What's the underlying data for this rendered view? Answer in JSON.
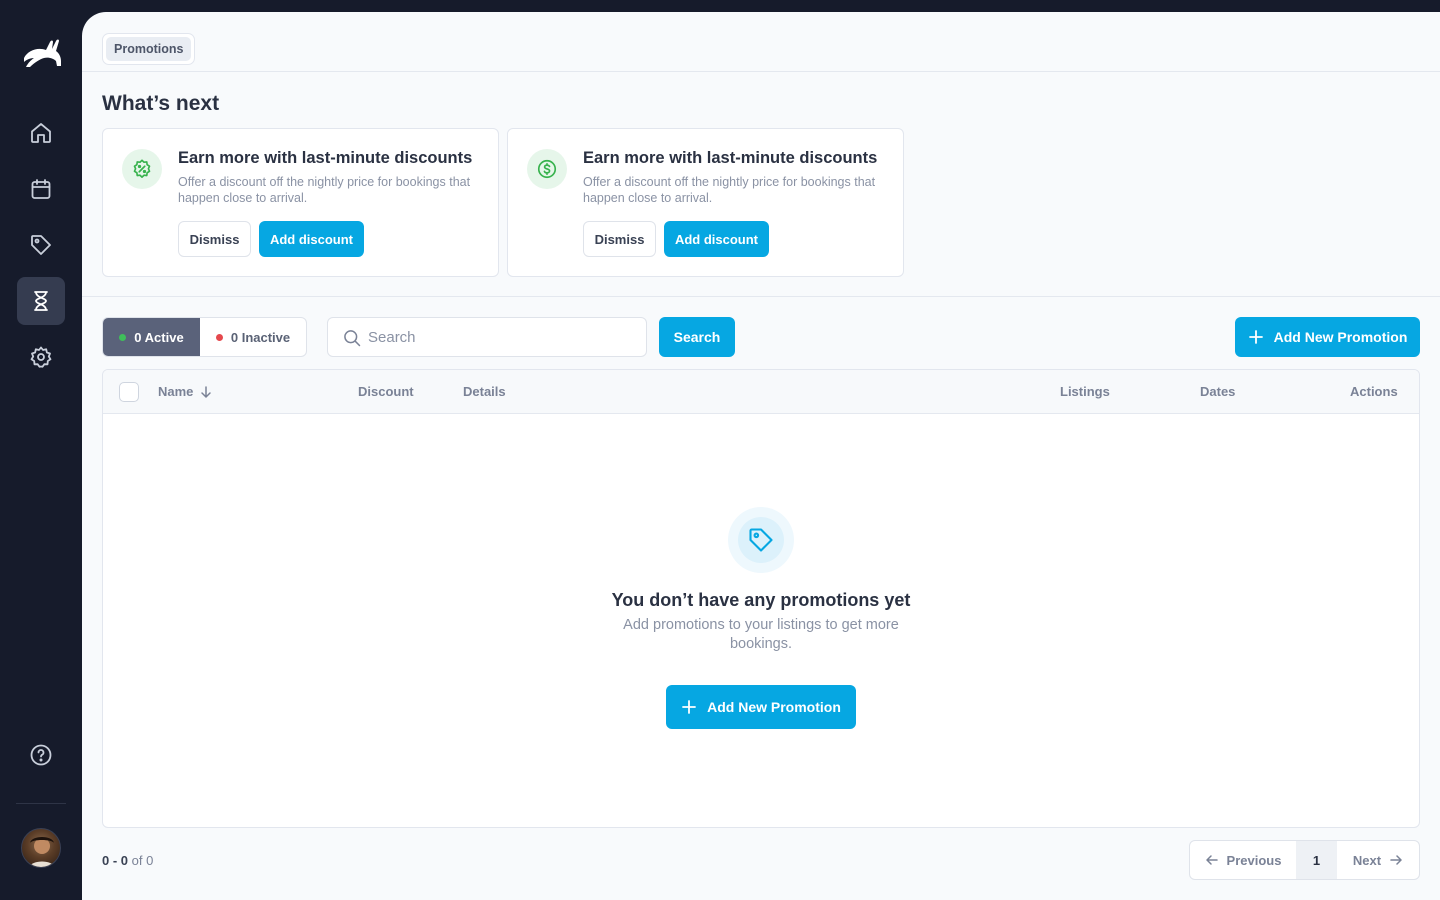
{
  "sidebar": {
    "logo": "rabbit-logo",
    "items": [
      {
        "name": "home",
        "icon": "home-icon",
        "active": false
      },
      {
        "name": "calendar",
        "icon": "calendar-icon",
        "active": false
      },
      {
        "name": "tags",
        "icon": "tag-icon",
        "active": false
      },
      {
        "name": "promotions",
        "icon": "hourglass-icon",
        "active": true
      },
      {
        "name": "settings",
        "icon": "gear-icon",
        "active": false
      }
    ],
    "help_icon": "help-icon",
    "avatar": "user-avatar"
  },
  "header": {
    "breadcrumb": "Promotions"
  },
  "whats_next": {
    "title": "What’s next",
    "cards": [
      {
        "icon": "percent-badge-icon",
        "title": "Earn more with last-minute discounts",
        "description": "Offer a discount off the nightly price for bookings that happen close to arrival.",
        "dismiss_label": "Dismiss",
        "action_label": "Add discount"
      },
      {
        "icon": "dollar-circle-icon",
        "title": "Earn more with last-minute discounts",
        "description": "Offer a discount off the nightly price for bookings that happen close to arrival.",
        "dismiss_label": "Dismiss",
        "action_label": "Add discount"
      }
    ]
  },
  "filters": {
    "active_label": "0 Active",
    "inactive_label": "0 Inactive",
    "search_placeholder": "Search",
    "search_button": "Search",
    "add_button": "Add New Promotion"
  },
  "table": {
    "columns": [
      "Name",
      "Discount",
      "Details",
      "Listings",
      "Dates",
      "Actions"
    ],
    "empty": {
      "title": "You don’t have any promotions yet",
      "description": "Add promotions to your listings to get more bookings.",
      "button": "Add New Promotion"
    }
  },
  "pagination": {
    "range_start": "0",
    "range_end": "0",
    "of_label": "of",
    "total": "0",
    "previous": "Previous",
    "current_page": "1",
    "next": "Next"
  },
  "colors": {
    "accent": "#06a7e2",
    "sidebar": "#161b2b",
    "active_dot": "#3fbf5a",
    "inactive_dot": "#e5484d"
  }
}
